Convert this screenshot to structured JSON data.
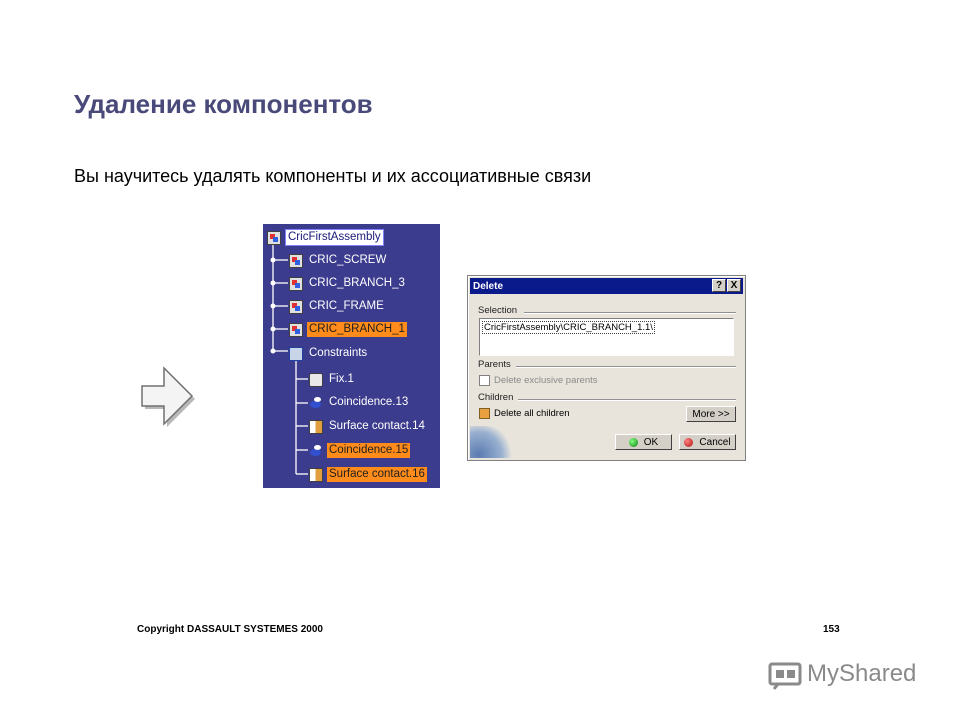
{
  "slide": {
    "title": "Удаление компонентов",
    "subtitle": "Вы научитесь удалять компоненты и их ассоциативные связи"
  },
  "tree": {
    "root": "CricFirstAssembly",
    "products": [
      "CRIC_SCREW",
      "CRIC_BRANCH_3",
      "CRIC_FRAME",
      "CRIC_BRANCH_1"
    ],
    "constraints_label": "Constraints",
    "constraints": [
      "Fix.1",
      "Coincidence.13",
      "Surface contact.14",
      "Coincidence.15",
      "Surface contact.16"
    ],
    "colors": {
      "panel": "#3c3c8e",
      "highlight": "#ff8c1a"
    }
  },
  "dialog": {
    "title": "Delete",
    "help_label": "?",
    "close_label": "X",
    "selection_label": "Selection",
    "selection_value": "CricFirstAssembly\\CRIC_BRANCH_1.1\\",
    "parents_label": "Parents",
    "delete_exclusive_parents": "Delete exclusive parents",
    "children_label": "Children",
    "delete_all_children": "Delete all children",
    "more_button": "More >>",
    "ok_button": "OK",
    "cancel_button": "Cancel"
  },
  "footer": {
    "copyright": "Copyright DASSAULT SYSTEMES 2000",
    "page_number": "153",
    "brand": "MyShared"
  }
}
